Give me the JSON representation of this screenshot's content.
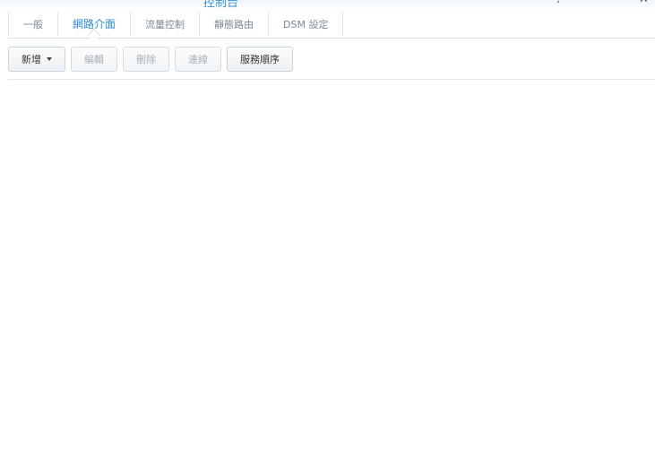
{
  "window": {
    "title": "控制台",
    "controls": [
      "?",
      "—",
      "✕"
    ]
  },
  "tabs": [
    {
      "label": "一般",
      "active": false
    },
    {
      "label": "網路介面",
      "active": true
    },
    {
      "label": "流量控制",
      "active": false
    },
    {
      "label": "靜態路由",
      "active": false
    },
    {
      "label": "DSM 設定",
      "active": false
    }
  ],
  "toolbar": {
    "add_label": "新增",
    "edit_label": "編輯",
    "delete_label": "刪除",
    "connect_label": "連線",
    "service_order_label": "服務順序"
  },
  "colors": {
    "accent": "#2f8cd2",
    "disabled_text": "#aab3bb",
    "border": "#c8d3dc"
  }
}
